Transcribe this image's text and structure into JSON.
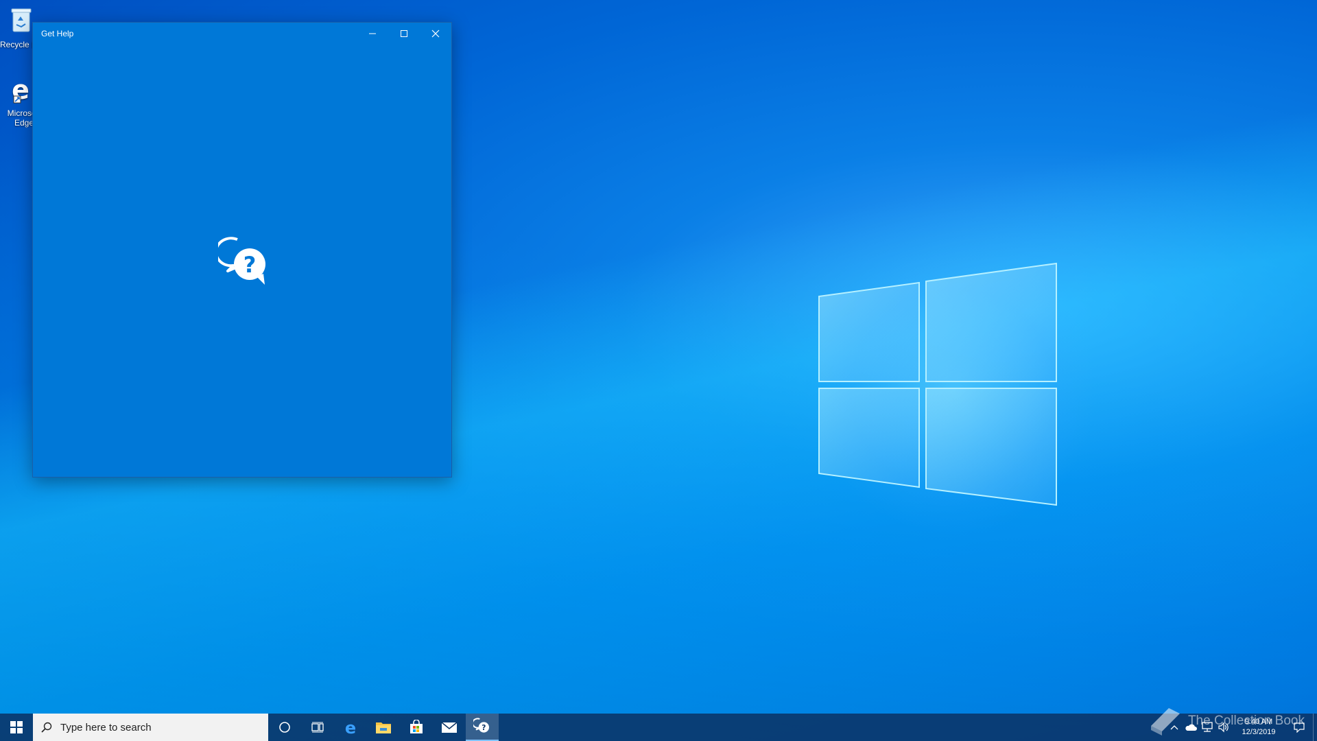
{
  "desktop": {
    "icons": [
      {
        "label": "Recycle Bin",
        "icon": "recycle-bin-icon"
      },
      {
        "label": "Microsoft Edge",
        "icon": "edge-icon"
      }
    ]
  },
  "window": {
    "title": "Get Help",
    "splash_icon": "chat-help-icon",
    "background": "#0078d7"
  },
  "taskbar": {
    "search_placeholder": "Type here to search",
    "pinned": [
      {
        "name": "Cortana",
        "icon": "cortana-icon"
      },
      {
        "name": "Task View",
        "icon": "task-view-icon"
      },
      {
        "name": "Microsoft Edge",
        "icon": "edge-icon"
      },
      {
        "name": "File Explorer",
        "icon": "file-explorer-icon"
      },
      {
        "name": "Microsoft Store",
        "icon": "store-icon"
      },
      {
        "name": "Mail",
        "icon": "mail-icon"
      },
      {
        "name": "Get Help",
        "icon": "chat-help-icon",
        "active": true
      }
    ],
    "clock": {
      "time": "9:40 AM",
      "date": "12/3/2019"
    }
  },
  "watermark": {
    "text": "The Collection Book"
  }
}
